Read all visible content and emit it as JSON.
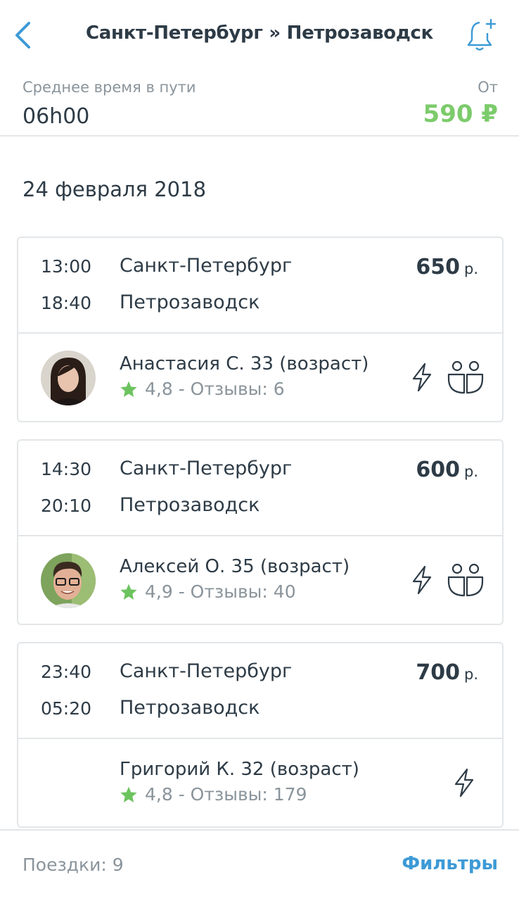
{
  "header": {
    "title": "Санкт-Петербург » Петрозаводск",
    "back_icon": "chevron-left-icon",
    "bell_icon": "bell-plus-icon",
    "accent": "#3d9ad6"
  },
  "summary": {
    "avg_time_label": "Среднее время в пути",
    "avg_time_value": "06h00",
    "from_label": "От",
    "from_price": "590 ₽",
    "price_color": "#7ccb6b"
  },
  "date": "24 февраля 2018",
  "trips": [
    {
      "dep_time": "13:00",
      "arr_time": "18:40",
      "from": "Санкт-Петербург",
      "to": "Петрозаводск",
      "price": "650",
      "currency": "р.",
      "driver": "Анастасия С. 33 (возраст)",
      "rating": "4,8 - Отзывы: 6",
      "has_avatar": true,
      "instant_icon": "lightning-icon",
      "seats_icon": "two-passengers-icon"
    },
    {
      "dep_time": "14:30",
      "arr_time": "20:10",
      "from": "Санкт-Петербург",
      "to": "Петрозаводск",
      "price": "600",
      "currency": "р.",
      "driver": "Алексей О. 35 (возраст)",
      "rating": "4,9 - Отзывы: 40",
      "has_avatar": true,
      "instant_icon": "lightning-icon",
      "seats_icon": "two-passengers-icon"
    },
    {
      "dep_time": "23:40",
      "arr_time": "05:20",
      "from": "Санкт-Петербург",
      "to": "Петрозаводск",
      "price": "700",
      "currency": "р.",
      "driver": "Григорий К. 32 (возраст)",
      "rating": "4,8 - Отзывы: 179",
      "has_avatar": false,
      "instant_icon": "lightning-icon"
    }
  ],
  "footer": {
    "trips_count": "Поездки: 9",
    "filters_label": "Фильтры"
  },
  "colors": {
    "star": "#6cc35e",
    "text": "#2d3b46",
    "muted": "#8a949b"
  }
}
